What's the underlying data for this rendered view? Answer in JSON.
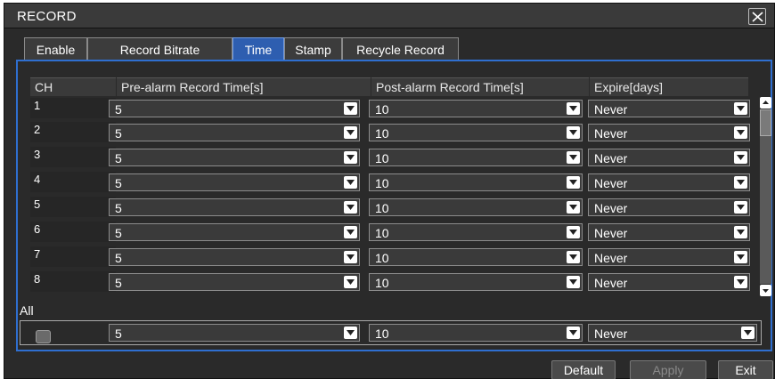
{
  "window": {
    "title": "RECORD"
  },
  "tabs": [
    {
      "label": "Enable",
      "active": false
    },
    {
      "label": "Record Bitrate",
      "active": false
    },
    {
      "label": "Time",
      "active": true
    },
    {
      "label": "Stamp",
      "active": false
    },
    {
      "label": "Recycle Record",
      "active": false
    }
  ],
  "table": {
    "headers": [
      "CH",
      "Pre-alarm Record Time[s]",
      "Post-alarm Record Time[s]",
      "Expire[days]"
    ],
    "rows": [
      {
        "ch": "1",
        "pre": "5",
        "post": "10",
        "expire": "Never"
      },
      {
        "ch": "2",
        "pre": "5",
        "post": "10",
        "expire": "Never"
      },
      {
        "ch": "3",
        "pre": "5",
        "post": "10",
        "expire": "Never"
      },
      {
        "ch": "4",
        "pre": "5",
        "post": "10",
        "expire": "Never"
      },
      {
        "ch": "5",
        "pre": "5",
        "post": "10",
        "expire": "Never"
      },
      {
        "ch": "6",
        "pre": "5",
        "post": "10",
        "expire": "Never"
      },
      {
        "ch": "7",
        "pre": "5",
        "post": "10",
        "expire": "Never"
      },
      {
        "ch": "8",
        "pre": "5",
        "post": "10",
        "expire": "Never"
      }
    ]
  },
  "all": {
    "label": "All",
    "checked": false,
    "pre": "5",
    "post": "10",
    "expire": "Never"
  },
  "buttons": {
    "default": "Default",
    "apply": "Apply",
    "exit": "Exit"
  },
  "icons": {
    "close": "close-icon",
    "dropdown": "chevron-down-icon",
    "scroll_up": "arrow-up-icon",
    "scroll_down": "arrow-down-icon"
  },
  "colors": {
    "accent": "#2f6fd0",
    "active_tab": "#2e5eb0",
    "background": "#2a2a2a"
  }
}
